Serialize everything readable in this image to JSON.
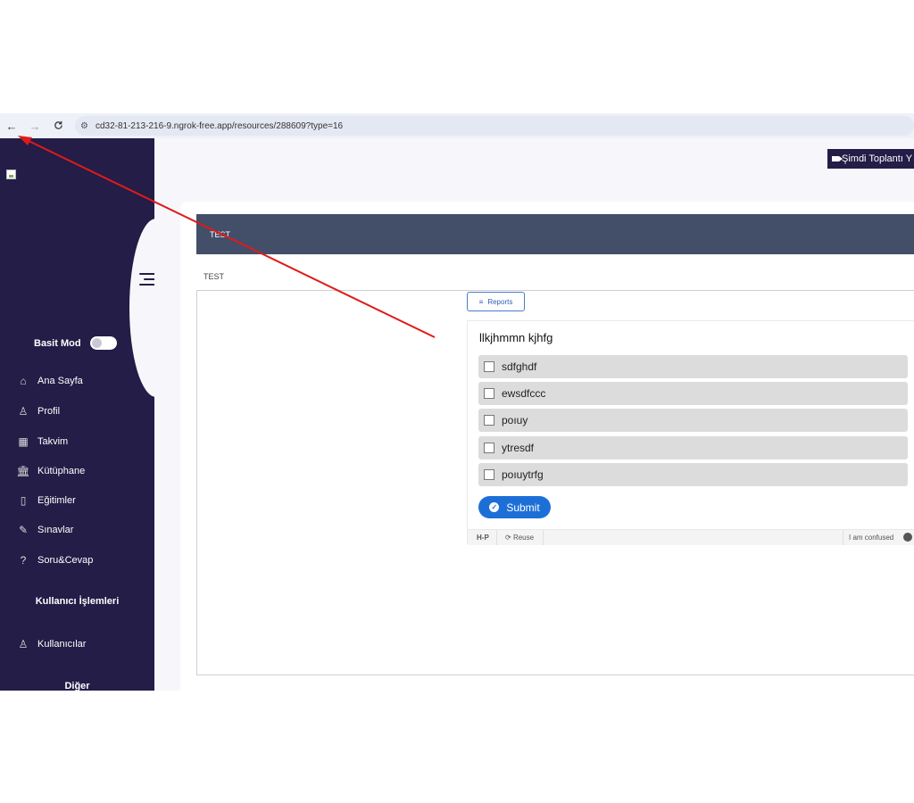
{
  "browser": {
    "back_icon": "←",
    "forward_icon": "→",
    "reload_icon": "C",
    "url": "cd32-81-213-216-9.ngrok-free.app/resources/288609?type=16"
  },
  "sidebar": {
    "basit_mod_label": "Basit Mod",
    "items": [
      {
        "label": "Ana Sayfa",
        "icon": "⌂"
      },
      {
        "label": "Profil",
        "icon": "♙"
      },
      {
        "label": "Takvim",
        "icon": "▦"
      },
      {
        "label": "Kütüphane",
        "icon": "🏛"
      },
      {
        "label": "Eğitimler",
        "icon": "▯"
      },
      {
        "label": "Sınavlar",
        "icon": "✎"
      },
      {
        "label": "Soru&Cevap",
        "icon": "?"
      }
    ],
    "section_user": "Kullanıcı İşlemleri",
    "user_items": [
      {
        "label": "Kullanıcılar",
        "icon": "♙"
      }
    ],
    "section_other": "Diğer"
  },
  "header": {
    "meeting_button": "Şimdi Toplantı Y"
  },
  "content": {
    "header_title": "TEST",
    "subtitle": "TEST",
    "reports_label": "Reports",
    "question": "llkjhmmn kjhfg",
    "options": [
      "sdfghdf",
      "ewsdfccc",
      "poıuy",
      "ytresdf",
      "poıuytrfg"
    ],
    "submit_label": "Submit",
    "footer": {
      "h5p": "H‑P",
      "reuse": "Reuse",
      "confused": "I am confused"
    }
  },
  "colors": {
    "sidebar": "#231d47",
    "card_header": "#434e69",
    "submit": "#1d6fd8",
    "arrow": "#e01a1a"
  }
}
